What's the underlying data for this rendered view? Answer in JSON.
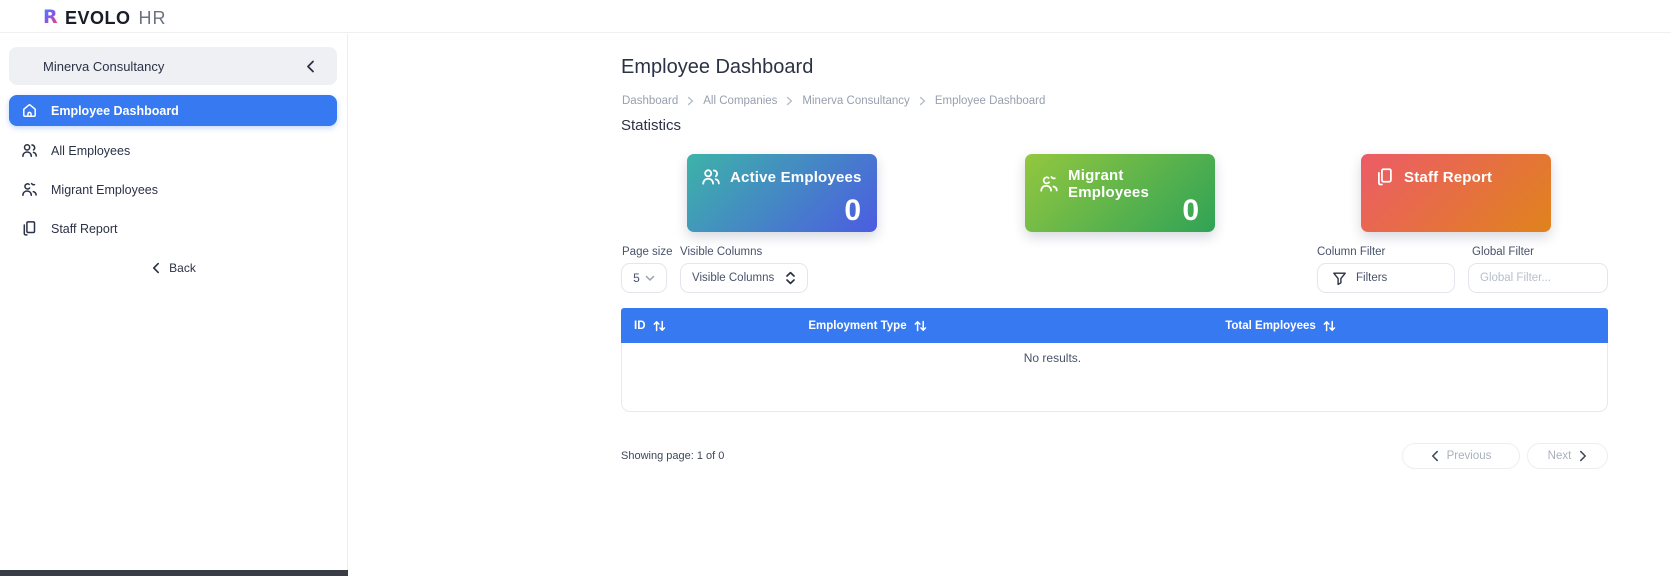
{
  "theme": {
    "accent": "#3779f0",
    "text_dark": "#2b3245",
    "text_gray": "#97a0ae",
    "border": "#e8eaee",
    "sidebar_header_bg": "#eef0f4"
  },
  "topbar": {
    "logo_mark": "R",
    "logo_text": "EVOLO",
    "logo_suffix": "HR"
  },
  "sidebar": {
    "company": "Minerva Consultancy",
    "items": [
      {
        "label": "Employee Dashboard",
        "icon": "home-icon",
        "active": true
      },
      {
        "label": "All Employees",
        "icon": "users-icon",
        "active": false
      },
      {
        "label": "Migrant Employees",
        "icon": "users-alt-icon",
        "active": false
      },
      {
        "label": "Staff Report",
        "icon": "documents-icon",
        "active": false
      }
    ],
    "back_label": "Back"
  },
  "page": {
    "title": "Employee Dashboard",
    "breadcrumb": [
      "Dashboard",
      "All Companies",
      "Minerva Consultancy",
      "Employee Dashboard"
    ],
    "statistics_heading": "Statistics"
  },
  "statistics": {
    "cards": [
      {
        "label": "Active Employees",
        "value": "0",
        "icon": "users-icon",
        "gradient_from": "#3db3a8",
        "gradient_to": "#4c5ce1"
      },
      {
        "label": "Migrant Employees",
        "value": "0",
        "icon": "users-alt-icon",
        "gradient_from": "#93c73f",
        "gradient_to": "#2fa356"
      },
      {
        "label": "Staff Report",
        "value": "",
        "icon": "documents-icon",
        "gradient_from": "#ec5b68",
        "gradient_to": "#e0831c"
      }
    ]
  },
  "controls": {
    "page_size_label": "Page size",
    "page_size_value": "5",
    "visible_columns_label": "Visible Columns",
    "visible_columns_value": "Visible Columns",
    "column_filter_label": "Column Filter",
    "filters_button_label": "Filters",
    "global_filter_label": "Global Filter",
    "global_filter_placeholder": "Global Filter..."
  },
  "table": {
    "columns": [
      {
        "label": "ID"
      },
      {
        "label": "Employment Type"
      },
      {
        "label": "Total Employees"
      }
    ],
    "empty_text": "No results."
  },
  "pagination": {
    "summary": "Showing page: 1 of 0",
    "previous_label": "Previous",
    "next_label": "Next"
  },
  "icons": {
    "chevron_left": "‹",
    "chevron_right": "›",
    "chevron_down": "⌄",
    "chevron_up_down": "⇅",
    "sort": "⇅",
    "home": "⌂",
    "users": "👤",
    "documents": "🗎",
    "funnel": "▽"
  }
}
